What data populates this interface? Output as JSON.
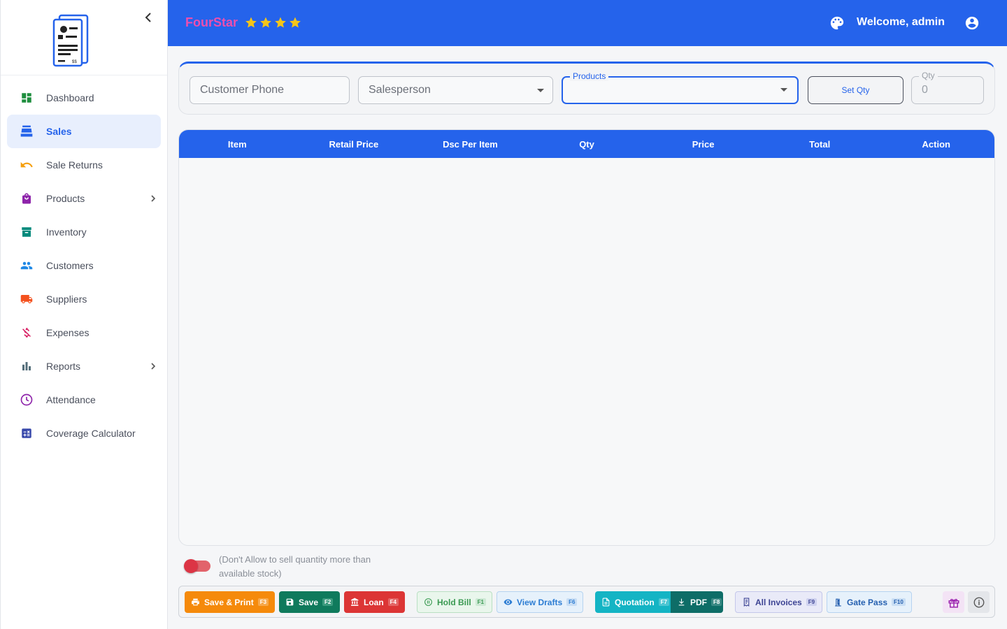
{
  "brand": {
    "name": "FourStar",
    "star_count": 4,
    "star_color": "#f5c518",
    "name_color": "#ec4fae"
  },
  "header": {
    "welcome": "Welcome, admin",
    "bg_color": "#2563eb"
  },
  "sidebar": {
    "items": [
      {
        "label": "Dashboard",
        "icon": "dashboard-icon",
        "color": "#1e8e3e",
        "active": false,
        "expandable": false
      },
      {
        "label": "Sales",
        "icon": "cash-register-icon",
        "color": "#2563eb",
        "active": true,
        "expandable": false
      },
      {
        "label": "Sale Returns",
        "icon": "undo-icon",
        "color": "#f59e0b",
        "active": false,
        "expandable": false
      },
      {
        "label": "Products",
        "icon": "shopping-bag-icon",
        "color": "#8e24aa",
        "active": false,
        "expandable": true
      },
      {
        "label": "Inventory",
        "icon": "archive-box-icon",
        "color": "#00897b",
        "active": false,
        "expandable": false
      },
      {
        "label": "Customers",
        "icon": "people-icon",
        "color": "#1e88e5",
        "active": false,
        "expandable": false
      },
      {
        "label": "Suppliers",
        "icon": "truck-icon",
        "color": "#f4511e",
        "active": false,
        "expandable": false
      },
      {
        "label": "Expenses",
        "icon": "money-off-icon",
        "color": "#d81b60",
        "active": false,
        "expandable": false
      },
      {
        "label": "Reports",
        "icon": "bar-chart-icon",
        "color": "#546e7a",
        "active": false,
        "expandable": true
      },
      {
        "label": "Attendance",
        "icon": "clock-icon",
        "color": "#8e24aa",
        "active": false,
        "expandable": false
      },
      {
        "label": "Coverage Calculator",
        "icon": "calculator-icon",
        "color": "#3949ab",
        "active": false,
        "expandable": false
      }
    ]
  },
  "filters": {
    "customer_phone_placeholder": "Customer Phone",
    "salesperson_placeholder": "Salesperson",
    "products_label": "Products",
    "set_qty_label": "Set Qty",
    "qty_label": "Qty",
    "qty_value": "0"
  },
  "table": {
    "columns": [
      "Item",
      "Retail Price",
      "Dsc Per Item",
      "Qty",
      "Price",
      "Total",
      "Action"
    ],
    "rows": []
  },
  "stock_toggle": {
    "enabled": false,
    "text": "(Don't Allow to sell quantity more than available stock)"
  },
  "actions": {
    "save_print": {
      "label": "Save & Print",
      "key": "F3"
    },
    "save": {
      "label": "Save",
      "key": "F2"
    },
    "loan": {
      "label": "Loan",
      "key": "F4"
    },
    "hold_bill": {
      "label": "Hold Bill",
      "key": "F1"
    },
    "view_drafts": {
      "label": "View Drafts",
      "key": "F6"
    },
    "quotation": {
      "label": "Quotation",
      "key": "F7"
    },
    "pdf": {
      "label": "PDF",
      "key": "F8"
    },
    "all_invoices": {
      "label": "All Invoices",
      "key": "F9"
    },
    "gate_pass": {
      "label": "Gate Pass",
      "key": "F10"
    }
  }
}
